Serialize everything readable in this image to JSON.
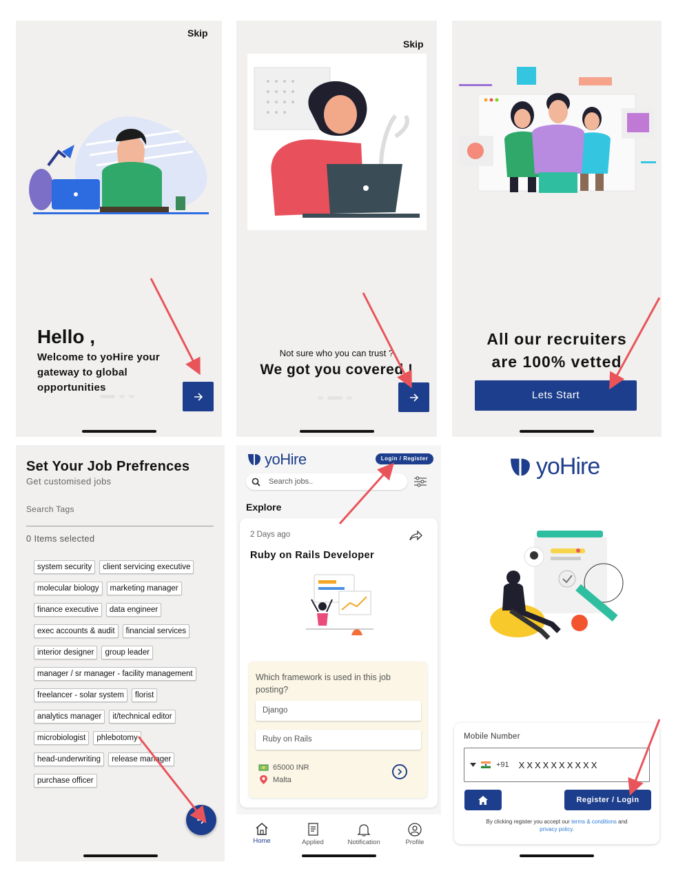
{
  "screen1": {
    "skip": "Skip",
    "hello": "Hello ,",
    "welcome": "Welcome to yoHire your gateway to global opportunities",
    "next_icon": "arrow-right-icon"
  },
  "screen2": {
    "skip": "Skip",
    "question": "Not sure who you can trust ?",
    "headline": "We got you covered !",
    "next_icon": "arrow-right-icon"
  },
  "screen3": {
    "headline_line1": "All our recruiters",
    "headline_line2": "are 100% vetted",
    "start_button": "Lets Start"
  },
  "screen4": {
    "title": "Set Your Job Prefrences",
    "subtitle": "Get customised jobs",
    "search_placeholder": "Search Tags",
    "selected_count": "0 Items selected",
    "tag_rows": [
      [
        "system security",
        "client servicing executive"
      ],
      [
        "molecular biology",
        "marketing manager"
      ],
      [
        "finance executive",
        "data engineer"
      ],
      [
        "exec accounts & audit",
        "financial services"
      ],
      [
        "interior designer",
        "group leader"
      ],
      [
        "manager / sr manager - facility management"
      ],
      [
        "freelancer - solar system",
        "florist"
      ],
      [
        "analytics manager",
        "it/technical editor"
      ],
      [
        "microbiologist",
        "phlebotomy"
      ],
      [
        "head-underwriting",
        "release manager"
      ],
      [
        "purchase officer"
      ]
    ]
  },
  "screen5": {
    "logo": "yoHire",
    "login_button": "Login / Register",
    "search_placeholder": "Search jobs..",
    "section_title": "Explore",
    "card": {
      "posted": "2 Days ago",
      "title": "Ruby on Rails Developer",
      "quiz_question": "Which framework is used in this job posting?",
      "option1": "Django",
      "option2": "Ruby on Rails",
      "salary": "65000 INR",
      "location": "Malta"
    },
    "bottom_nav": [
      {
        "label": "Home",
        "icon": "home-icon",
        "active": true
      },
      {
        "label": "Applied",
        "icon": "document-icon",
        "active": false
      },
      {
        "label": "Notification",
        "icon": "bell-icon",
        "active": false
      },
      {
        "label": "Profile",
        "icon": "profile-icon",
        "active": false
      }
    ]
  },
  "screen6": {
    "logo": "yoHire",
    "mobile_label": "Mobile Number",
    "country_code": "+91",
    "phone_value": "XXXXXXXXXX",
    "register_button": "Register / Login",
    "terms_prefix": "By clicking register you accept our ",
    "terms_link": "terms & conditions",
    "terms_and": " and",
    "privacy_link": "privacy policy."
  },
  "colors": {
    "brand_blue": "#1d3e8c",
    "annotation_arrow": "#e8545a",
    "panel_bg": "#f1f0ee",
    "card_cream": "#fbf6e6"
  }
}
